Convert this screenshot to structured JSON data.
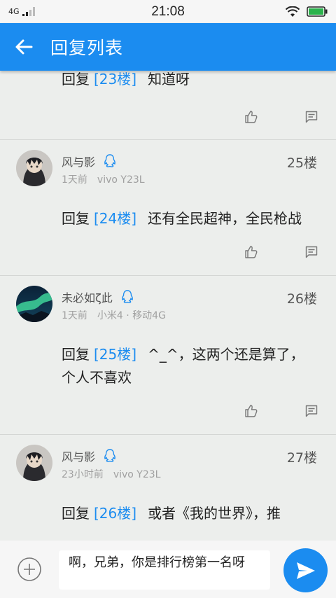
{
  "status": {
    "network": "4G",
    "time": "21:08"
  },
  "appbar": {
    "title": "回复列表"
  },
  "first_post_partial": {
    "reply_prefix": "回复",
    "floor_link": "[23楼]",
    "text": "知道呀"
  },
  "posts": [
    {
      "user": "风与影",
      "time": "1天前",
      "device": "vivo Y23L",
      "floor": "25楼",
      "reply_prefix": "回复",
      "floor_link": "[24楼]",
      "text": "还有全民超神，全民枪战"
    },
    {
      "user": "未必如ζ此",
      "time": "1天前",
      "device": "小米4 · 移动4G",
      "floor": "26楼",
      "reply_prefix": "回复",
      "floor_link": "[25楼]",
      "text": "^_^，这两个还是算了，个人不喜欢"
    },
    {
      "user": "风与影",
      "time": "23小时前",
      "device": "vivo Y23L",
      "floor": "27楼",
      "reply_prefix": "回复",
      "floor_link": "[26楼]",
      "text": "或者《我的世界》，推"
    }
  ],
  "composer": {
    "input_value": "啊，兄弟，你是排行榜第一名呀"
  },
  "colors": {
    "accent": "#1b8cf0",
    "background": "#eceeec"
  }
}
